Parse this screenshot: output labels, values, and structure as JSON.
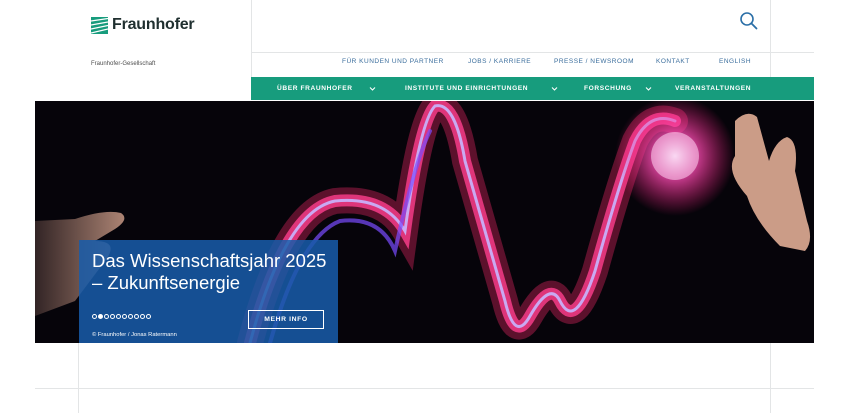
{
  "brand": {
    "name": "Fraunhofer",
    "org": "Fraunhofer-Gesellschaft",
    "color": "#179c7d"
  },
  "top_links": [
    "FÜR KUNDEN UND PARTNER",
    "JOBS / KARRIERE",
    "PRESSE / NEWSROOM",
    "KONTAKT",
    "ENGLISH"
  ],
  "main_nav": [
    "ÜBER FRAUNHOFER",
    "INSTITUTE UND EINRICHTUNGEN",
    "FORSCHUNG",
    "VERANSTALTUNGEN"
  ],
  "hero": {
    "title": "Das Wissenschaftsjahr 2025 – Zukunftsenergie",
    "button": "MEHR INFO",
    "credit": "© Fraunhofer / Jonas Ratermann",
    "slides_total": 10,
    "active_slide": 2
  },
  "icons": {
    "search": "search-icon",
    "logo": "fraunhofer-logo-icon"
  }
}
